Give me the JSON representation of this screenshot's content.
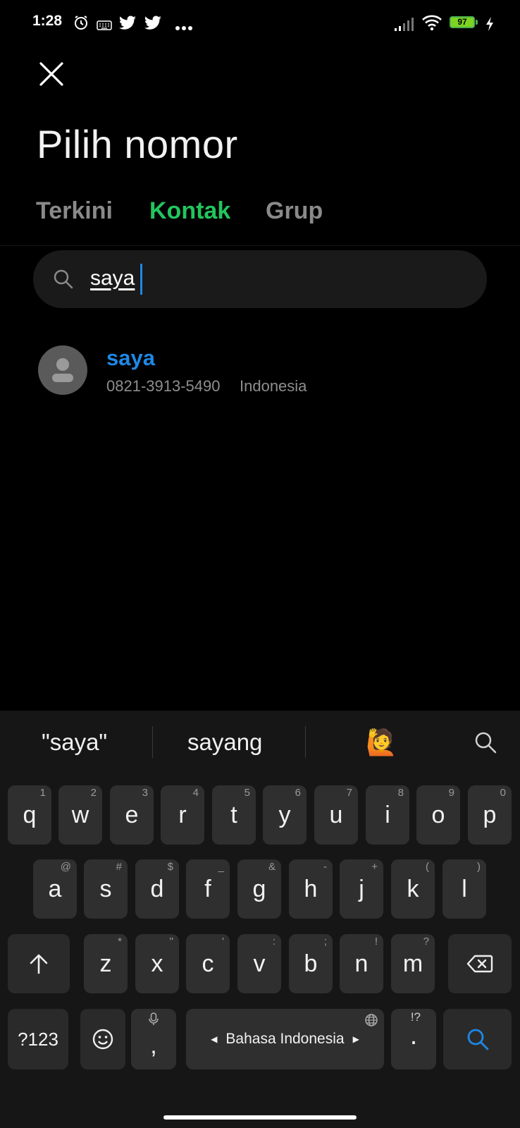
{
  "status_bar": {
    "time": "1:28",
    "battery": "97"
  },
  "header": {
    "title": "Pilih nomor"
  },
  "tabs": [
    {
      "label": "Terkini",
      "active": false
    },
    {
      "label": "Kontak",
      "active": true
    },
    {
      "label": "Grup",
      "active": false
    }
  ],
  "search": {
    "value": "saya"
  },
  "results": [
    {
      "name": "saya",
      "number": "0821-3913-5490",
      "country": "Indonesia"
    }
  ],
  "keyboard": {
    "suggestions": [
      "\"saya\"",
      "sayang",
      "🙋"
    ],
    "row1": [
      [
        "q",
        "1"
      ],
      [
        "w",
        "2"
      ],
      [
        "e",
        "3"
      ],
      [
        "r",
        "4"
      ],
      [
        "t",
        "5"
      ],
      [
        "y",
        "6"
      ],
      [
        "u",
        "7"
      ],
      [
        "i",
        "8"
      ],
      [
        "o",
        "9"
      ],
      [
        "p",
        "0"
      ]
    ],
    "row2": [
      [
        "a",
        "@"
      ],
      [
        "s",
        "#"
      ],
      [
        "d",
        "$"
      ],
      [
        "f",
        "_"
      ],
      [
        "g",
        "&"
      ],
      [
        "h",
        "-"
      ],
      [
        "j",
        "+"
      ],
      [
        "k",
        "("
      ],
      [
        "l",
        ")"
      ]
    ],
    "row3": [
      [
        "z",
        "*"
      ],
      [
        "x",
        "\""
      ],
      [
        "c",
        "'"
      ],
      [
        "v",
        ":"
      ],
      [
        "b",
        ";"
      ],
      [
        "n",
        "!"
      ],
      [
        "m",
        "?"
      ]
    ],
    "symbols_label": "?123",
    "comma": ",",
    "space_label": "Bahasa Indonesia",
    "period": ".",
    "period_hint": "!?"
  },
  "colors": {
    "accent_green": "#22c55e",
    "accent_blue": "#1e88e5"
  }
}
